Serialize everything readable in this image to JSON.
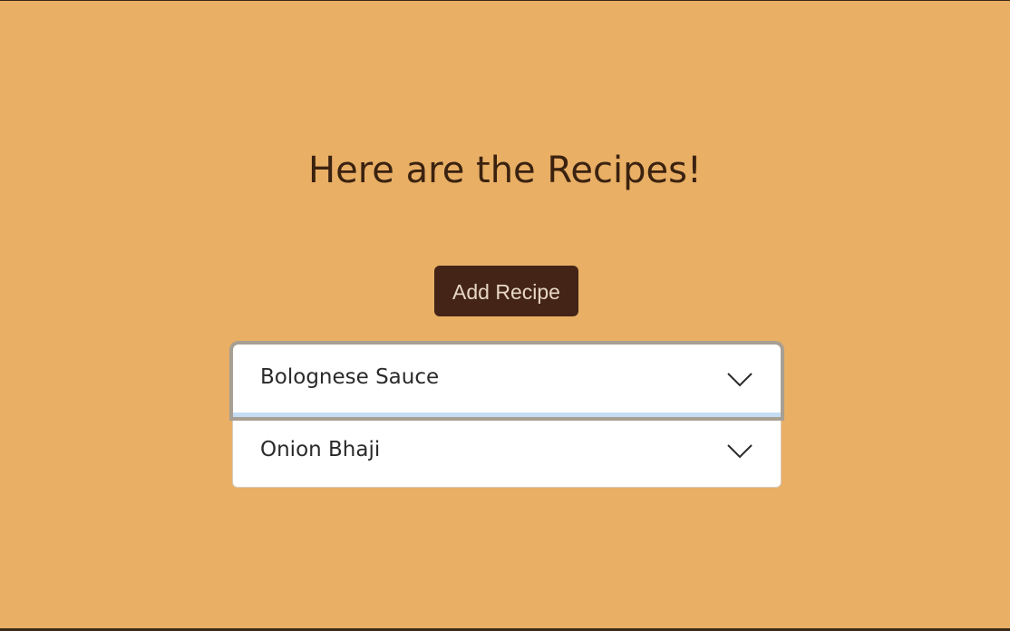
{
  "page": {
    "title": "Here are the Recipes!"
  },
  "toolbar": {
    "add_label": "Add Recipe"
  },
  "recipes": [
    {
      "name": "Bolognese Sauce",
      "expanded": false,
      "focused": true,
      "icon": "chevron-down-icon"
    },
    {
      "name": "Onion Bhaji",
      "expanded": false,
      "focused": false,
      "icon": "chevron-down-icon"
    }
  ],
  "colors": {
    "background": "#e8af65",
    "title_text": "#3b2210",
    "button_bg": "#432416",
    "button_text": "#e7d6c4",
    "card_bg": "#ffffff",
    "focus_ring": "#a89f93",
    "focus_underline": "#c5ddf3"
  }
}
